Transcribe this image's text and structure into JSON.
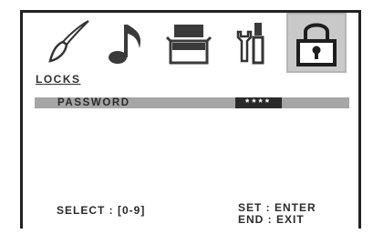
{
  "menu": {
    "tabs": [
      {
        "icon": "paintbrush-icon",
        "label": ""
      },
      {
        "icon": "music-note-icon",
        "label": ""
      },
      {
        "icon": "tv-box-icon",
        "label": ""
      },
      {
        "icon": "tools-icon",
        "label": ""
      },
      {
        "icon": "lock-icon",
        "label": "",
        "active": true
      }
    ],
    "active_tab_label": "LOCKS"
  },
  "settings": {
    "password_label": "PASSWORD",
    "password_value": "****"
  },
  "footer": {
    "select_hint": "SELECT : [0-9]",
    "set_hint": "SET : ENTER",
    "end_hint": "END : EXIT"
  },
  "colors": {
    "highlight_row": "#a6a6a6",
    "active_tab_bg": "#c9c9c9",
    "password_field_bg": "#2a2a2a",
    "icon_fill": "#3a3a3a"
  }
}
